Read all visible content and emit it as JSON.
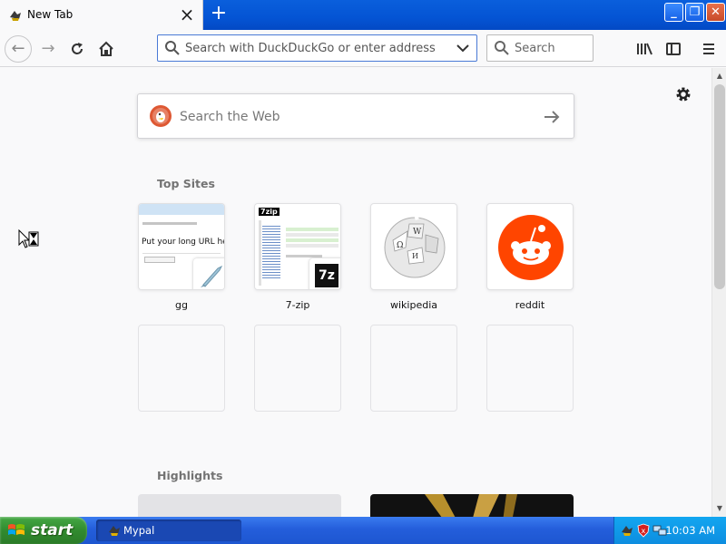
{
  "browser": {
    "tab": {
      "title": "New Tab"
    },
    "urlbar": {
      "placeholder": "Search with DuckDuckGo or enter address"
    },
    "searchbar": {
      "placeholder": "Search"
    }
  },
  "newtab": {
    "web_search": {
      "placeholder": "Search the Web"
    },
    "top_sites_title": "Top Sites",
    "top_sites": [
      {
        "label": "gg",
        "preview_text": "Put your long URL her"
      },
      {
        "label": "7-zip",
        "preview_text": "7zip"
      },
      {
        "label": "wikipedia"
      },
      {
        "label": "reddit"
      }
    ],
    "highlights_title": "Highlights"
  },
  "taskbar": {
    "start_label": "start",
    "task_label": "Mypal",
    "clock": "10:03 AM"
  },
  "colors": {
    "titlebar_blue": "#0454d4",
    "urlbar_focus": "#4a7ad6",
    "ddg_orange": "#de5833",
    "reddit_orange": "#ff4500",
    "start_green": "#318b2f"
  }
}
